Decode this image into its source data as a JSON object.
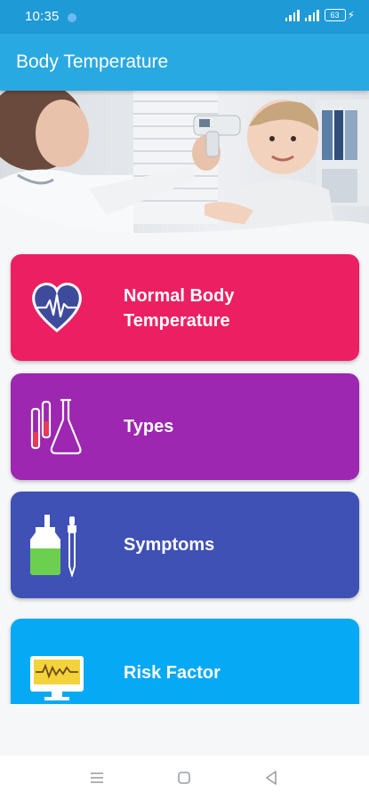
{
  "status_bar": {
    "time": "10:35",
    "battery_level": "63"
  },
  "app_bar": {
    "title": "Body Temperature"
  },
  "hero": {
    "description_icon": "doctor-child-thermometer-photo"
  },
  "menu": [
    {
      "label_line1": "Normal Body",
      "label_line2": "Temperature",
      "color": "#EC1F62",
      "icon": "heart-pulse-icon"
    },
    {
      "label": "Types",
      "color": "#9D27B0",
      "icon": "lab-flasks-icon"
    },
    {
      "label": "Symptoms",
      "color": "#3F51B5",
      "icon": "dropper-bottle-icon"
    },
    {
      "label": "Risk Factor",
      "color": "#05A9F4",
      "icon": "monitor-wave-icon"
    }
  ],
  "colors": {
    "status_bar": "#1E9AD6",
    "app_bar": "#29A9E1",
    "background": "#F6F7F9"
  },
  "nav_bar": {
    "icons": [
      "menu-icon",
      "home-square-icon",
      "back-triangle-icon"
    ]
  }
}
